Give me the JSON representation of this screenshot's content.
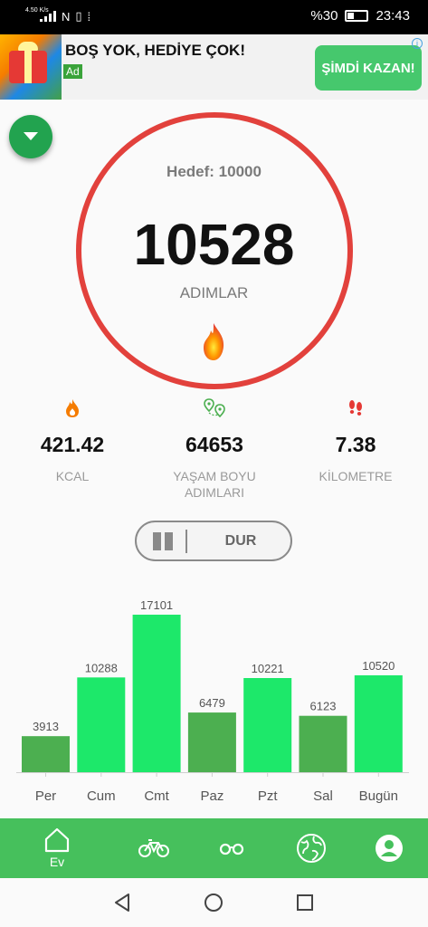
{
  "status_bar": {
    "network": "4.50 K/s",
    "battery": "%30",
    "time": "23:43"
  },
  "ad": {
    "title": "BOŞ YOK, HEDİYE ÇOK!",
    "tag": "Ad",
    "cta": "ŞİMDİ KAZAN!",
    "info": "i"
  },
  "goal_text": "Hedef: 10000",
  "steps": "10528",
  "steps_label": "ADIMLAR",
  "stats": {
    "kcal": {
      "value": "421.42",
      "label": "KCAL",
      "icon": "flame-icon"
    },
    "lifetime": {
      "value": "64653",
      "label_line1": "YAŞAM BOYU",
      "label_line2": "ADIMLARI",
      "icon": "location-pins-icon"
    },
    "km": {
      "value": "7.38",
      "label": "KİLOMETRE",
      "icon": "footprints-icon"
    }
  },
  "toggle": {
    "pause_icon": "pause-icon",
    "stop_label": "DUR"
  },
  "chart_data": {
    "type": "bar",
    "categories": [
      "Per",
      "Cum",
      "Cmt",
      "Paz",
      "Pzt",
      "Sal",
      "Bugün"
    ],
    "values": [
      3913,
      10288,
      17101,
      6479,
      10221,
      6123,
      10520
    ],
    "goal": 10000,
    "colors": {
      "above_goal": "#1de86a",
      "below_goal": "#4caf50"
    },
    "value_labels": true,
    "grid": false
  },
  "nav": {
    "home_label": "Ev",
    "items": [
      "home-icon",
      "bike-icon",
      "glasses-icon",
      "globe-icon",
      "profile-icon"
    ]
  },
  "system_nav": [
    "back-icon",
    "home-circle-icon",
    "recents-icon"
  ]
}
